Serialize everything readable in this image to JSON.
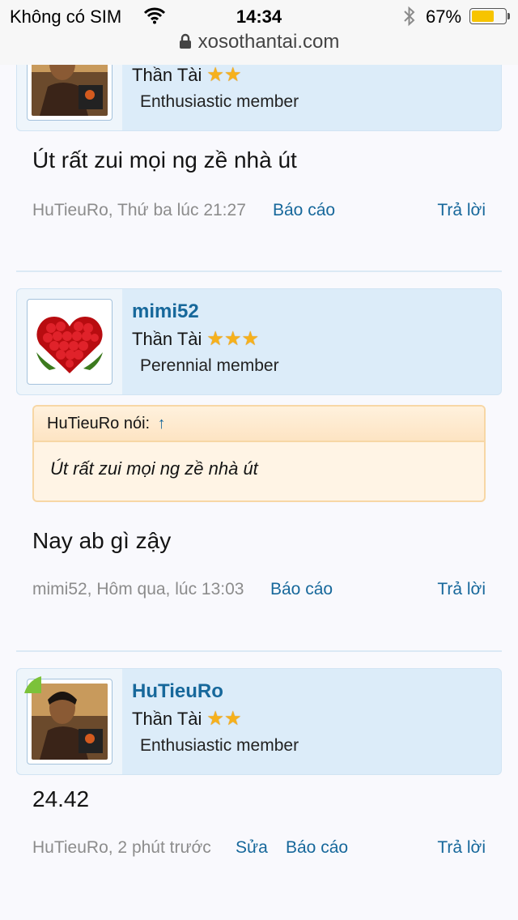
{
  "status_bar": {
    "carrier": "Không có SIM",
    "time": "14:34",
    "battery_percent": "67%",
    "battery_level": 0.67,
    "url": "xosothantai.com"
  },
  "icons": {
    "wifi": "wifi-icon",
    "bluetooth": "bluetooth-icon",
    "battery": "battery-icon",
    "lock": "lock-icon",
    "star": "star-icon"
  },
  "colors": {
    "link": "#17689b",
    "userbox_bg": "#dcecf9",
    "quote_bg": "#fff4e5",
    "star": "#f6b11c",
    "online": "#7cc23a"
  },
  "posts": [
    {
      "username": "",
      "title": "Thần Tài",
      "stars": 2,
      "rank": "Enthusiastic member",
      "text": "Út rất zui mọi ng zề nhà út",
      "meta": "HuTieuRo, Thứ ba lúc 21:27",
      "report": "Báo cáo",
      "reply": "Trả lời"
    },
    {
      "username": "mimi52",
      "title": "Thần Tài",
      "stars": 3,
      "rank": "Perennial member",
      "quote_author": "HuTieuRo nói:",
      "quote_arrow": "↑",
      "quote_text": "Út rất zui mọi ng zề nhà út",
      "text": "Nay ab gì zậy",
      "meta": "mimi52, Hôm qua, lúc 13:03",
      "report": "Báo cáo",
      "reply": "Trả lời"
    },
    {
      "username": "HuTieuRo",
      "title": "Thần Tài",
      "stars": 2,
      "rank": "Enthusiastic member",
      "text": "24.42",
      "meta": "HuTieuRo, 2 phút trước",
      "edit": "Sửa",
      "report": "Báo cáo",
      "reply": "Trả lời"
    }
  ]
}
